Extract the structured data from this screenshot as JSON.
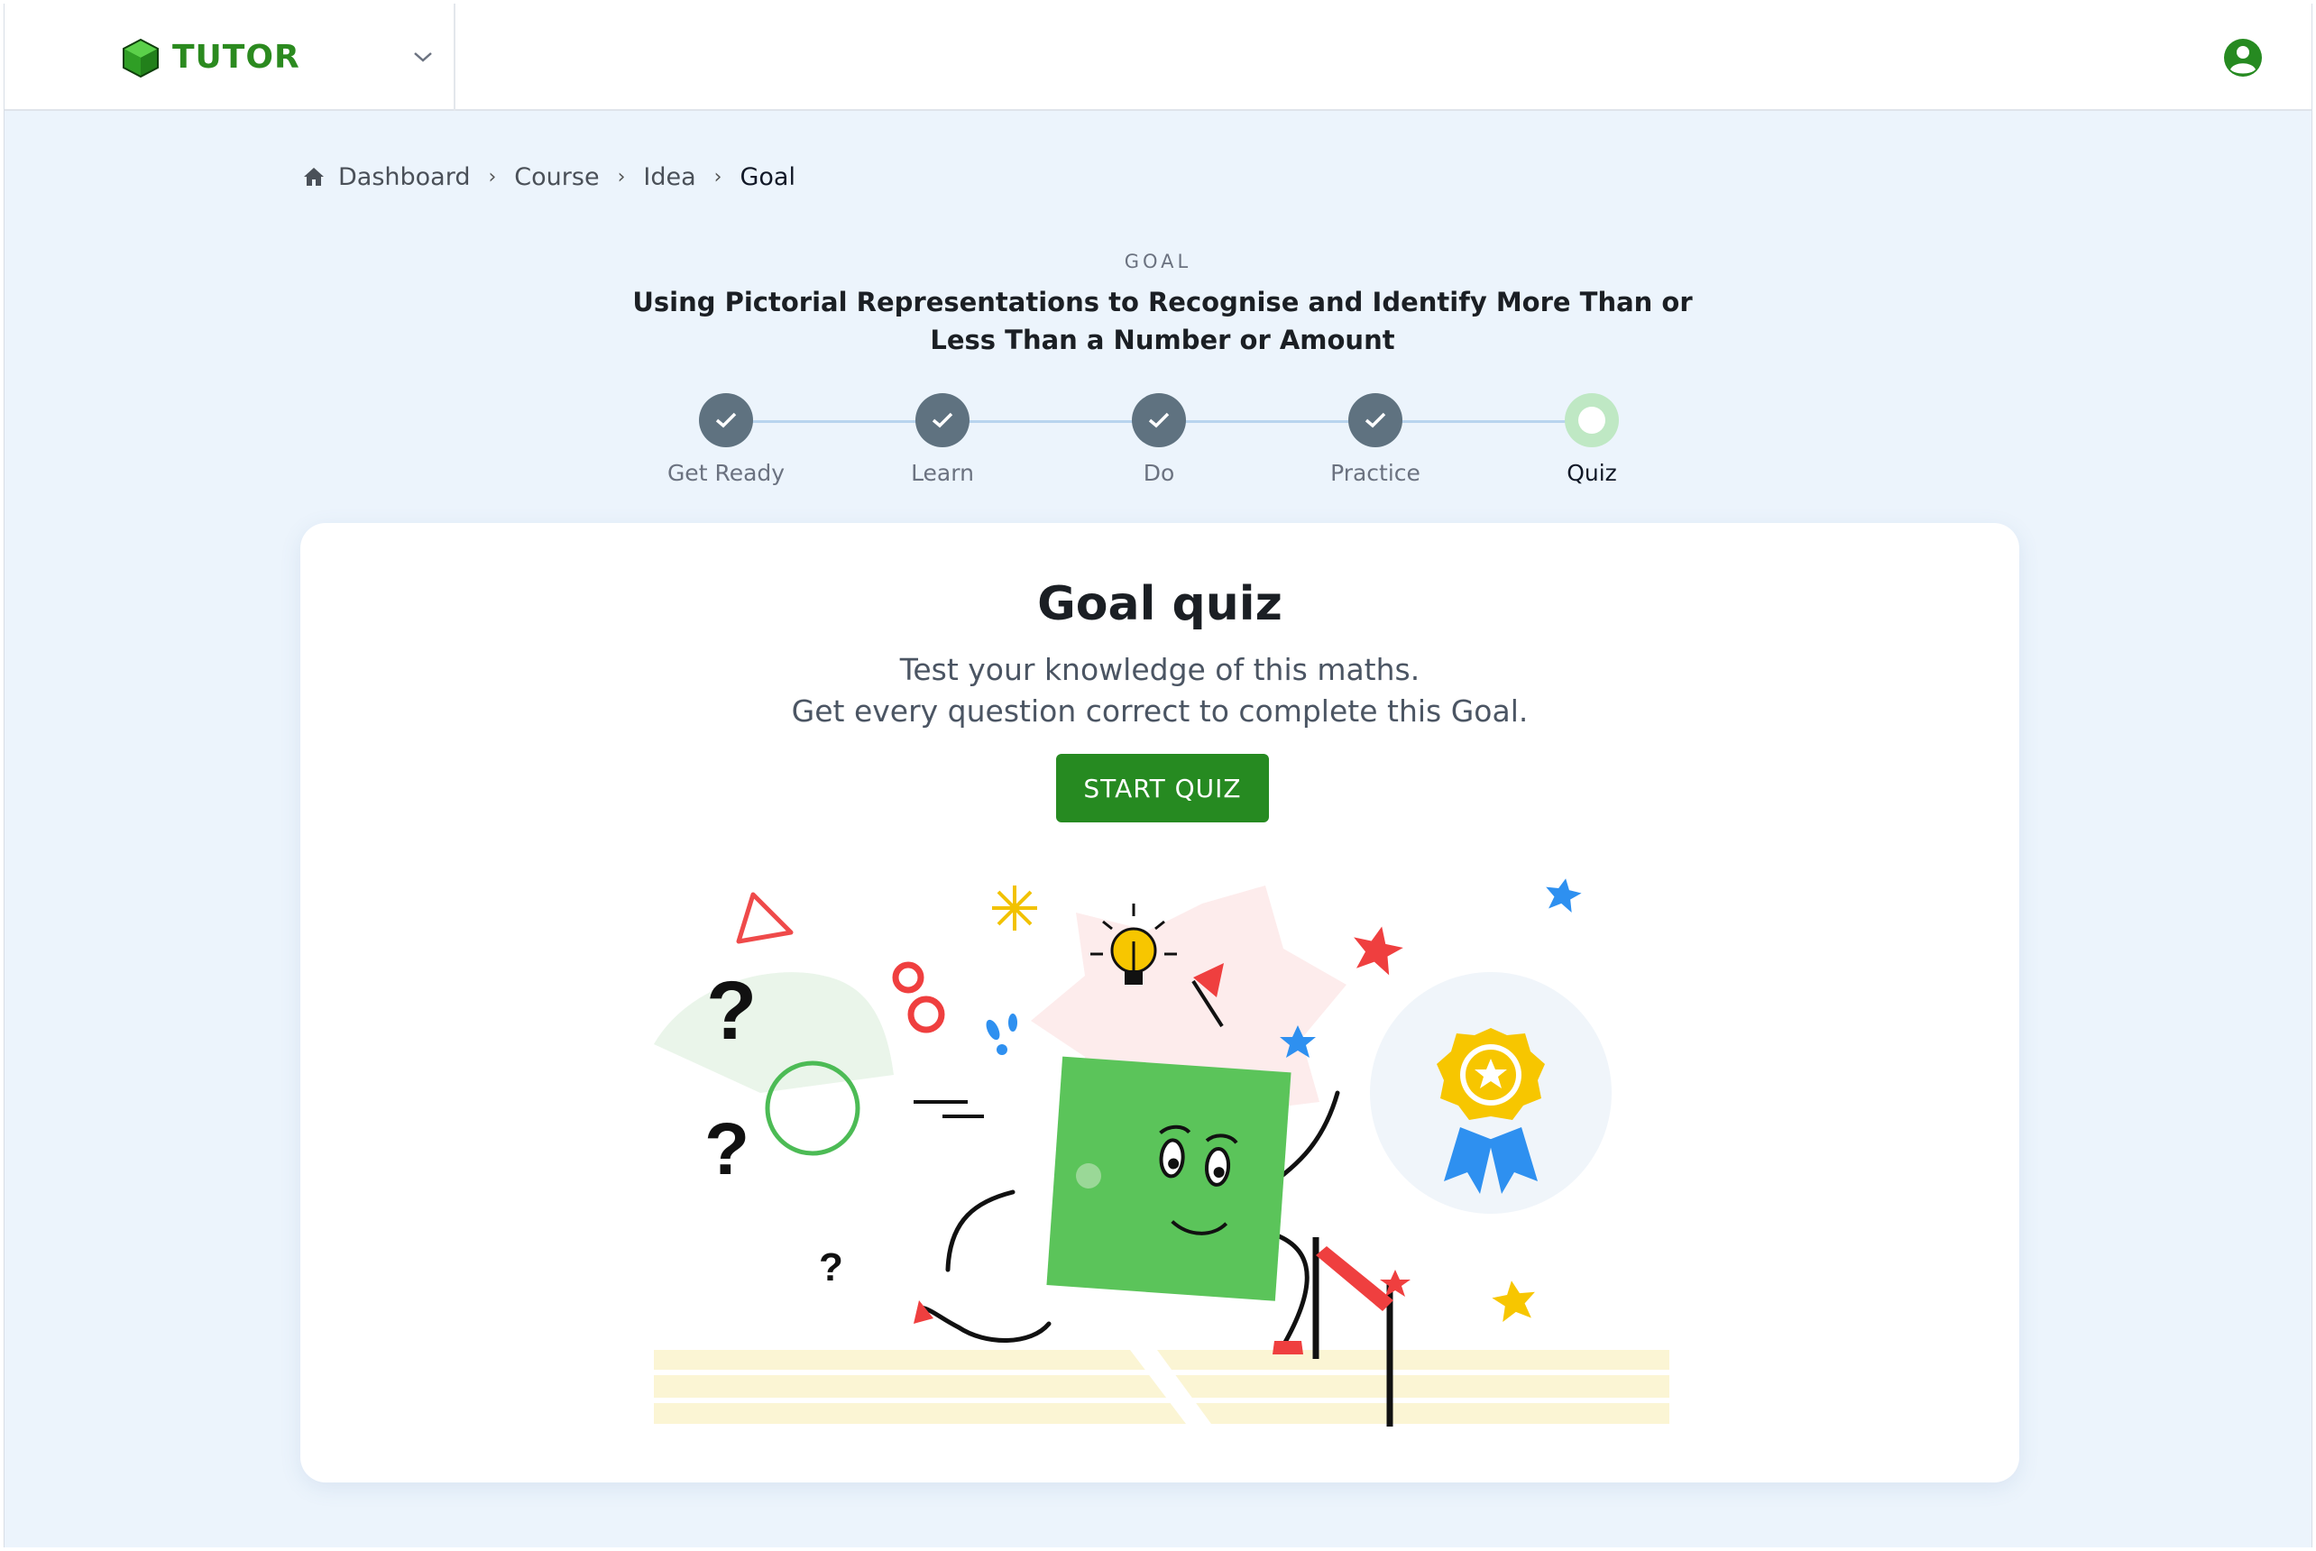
{
  "header": {
    "brand": "TUTOR",
    "logo_icon": "green-cube-icon",
    "menu_icon": "chevron-down-icon",
    "account_icon": "account-circle-icon",
    "brand_color": "#2b8a1f"
  },
  "breadcrumb": {
    "home_icon": "home-icon",
    "items": [
      "Dashboard",
      "Course",
      "Idea"
    ],
    "current": "Goal",
    "separator": "›"
  },
  "goal": {
    "eyebrow": "GOAL",
    "title": "Using Pictorial Representations to Recognise and Identify More Than or Less Than a Number or Amount"
  },
  "stepper": {
    "steps": [
      {
        "label": "Get Ready",
        "status": "complete"
      },
      {
        "label": "Learn",
        "status": "complete"
      },
      {
        "label": "Do",
        "status": "complete"
      },
      {
        "label": "Practice",
        "status": "complete"
      },
      {
        "label": "Quiz",
        "status": "current"
      }
    ],
    "complete_color": "#5f7280",
    "current_color": "#bfe8c4"
  },
  "quiz_card": {
    "title": "Goal quiz",
    "description_line1": "Test your knowledge of this maths.",
    "description_line2": "Get every question correct to complete this Goal.",
    "start_button": "START QUIZ",
    "button_color": "#268a21",
    "illustration": "running-square-character-illustration"
  }
}
